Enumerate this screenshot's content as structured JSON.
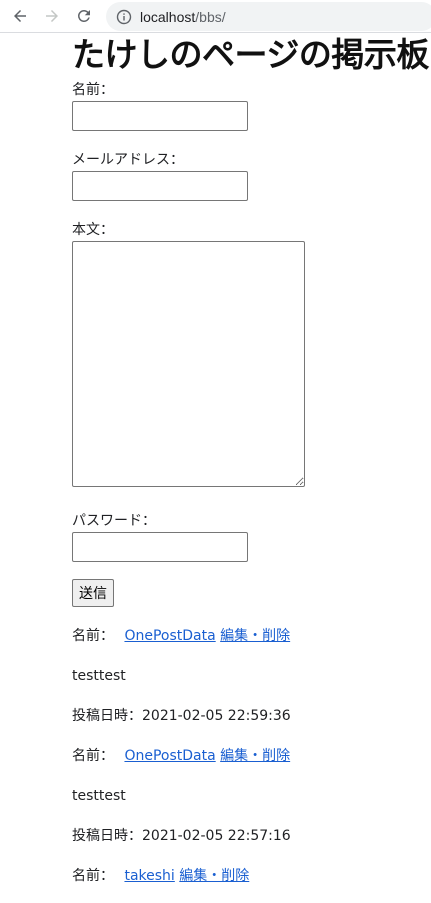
{
  "browser": {
    "url_host": "localhost",
    "url_path": "/bbs/"
  },
  "page": {
    "title": "たけしのページの掲示板"
  },
  "form": {
    "name_label": "名前：",
    "name_value": "",
    "email_label": "メールアドレス：",
    "email_value": "",
    "body_label": "本文：",
    "body_value": "",
    "password_label": "パスワード：",
    "password_value": "",
    "submit_label": "送信"
  },
  "posts": [
    {
      "name_label": "名前：",
      "name": "OnePostData",
      "edit_link": "編集・削除",
      "body": "testtest",
      "date_label": "投稿日時：",
      "date": "2021-02-05 22:59:36"
    },
    {
      "name_label": "名前：",
      "name": "OnePostData",
      "edit_link": "編集・削除",
      "body": "testtest",
      "date_label": "投稿日時：",
      "date": "2021-02-05 22:57:16"
    },
    {
      "name_label": "名前：",
      "name": "takeshi",
      "edit_link": "編集・削除"
    }
  ]
}
